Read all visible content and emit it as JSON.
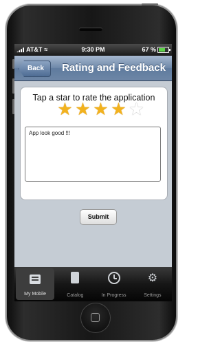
{
  "status_bar": {
    "carrier": "AT&T",
    "time": "9:30 PM",
    "battery": "67 %"
  },
  "nav": {
    "back_label": "Back",
    "title": "Rating and Feedback"
  },
  "rating": {
    "prompt": "Tap a star to rate the application",
    "value": 4,
    "max": 5
  },
  "feedback": {
    "text": "App look good !!!"
  },
  "submit_label": "Submit",
  "tabs": [
    {
      "label": "My Mobile",
      "icon": "my-mobile-icon",
      "active": true
    },
    {
      "label": "Catalog",
      "icon": "catalog-icon",
      "active": false
    },
    {
      "label": "In Progress",
      "icon": "clock-icon",
      "active": false
    },
    {
      "label": "Settings",
      "icon": "gear-icon",
      "active": false
    }
  ],
  "colors": {
    "nav_bar": "#6d87a8",
    "star_on": "#f2b21e",
    "screen_bg": "#c5ccd4"
  }
}
